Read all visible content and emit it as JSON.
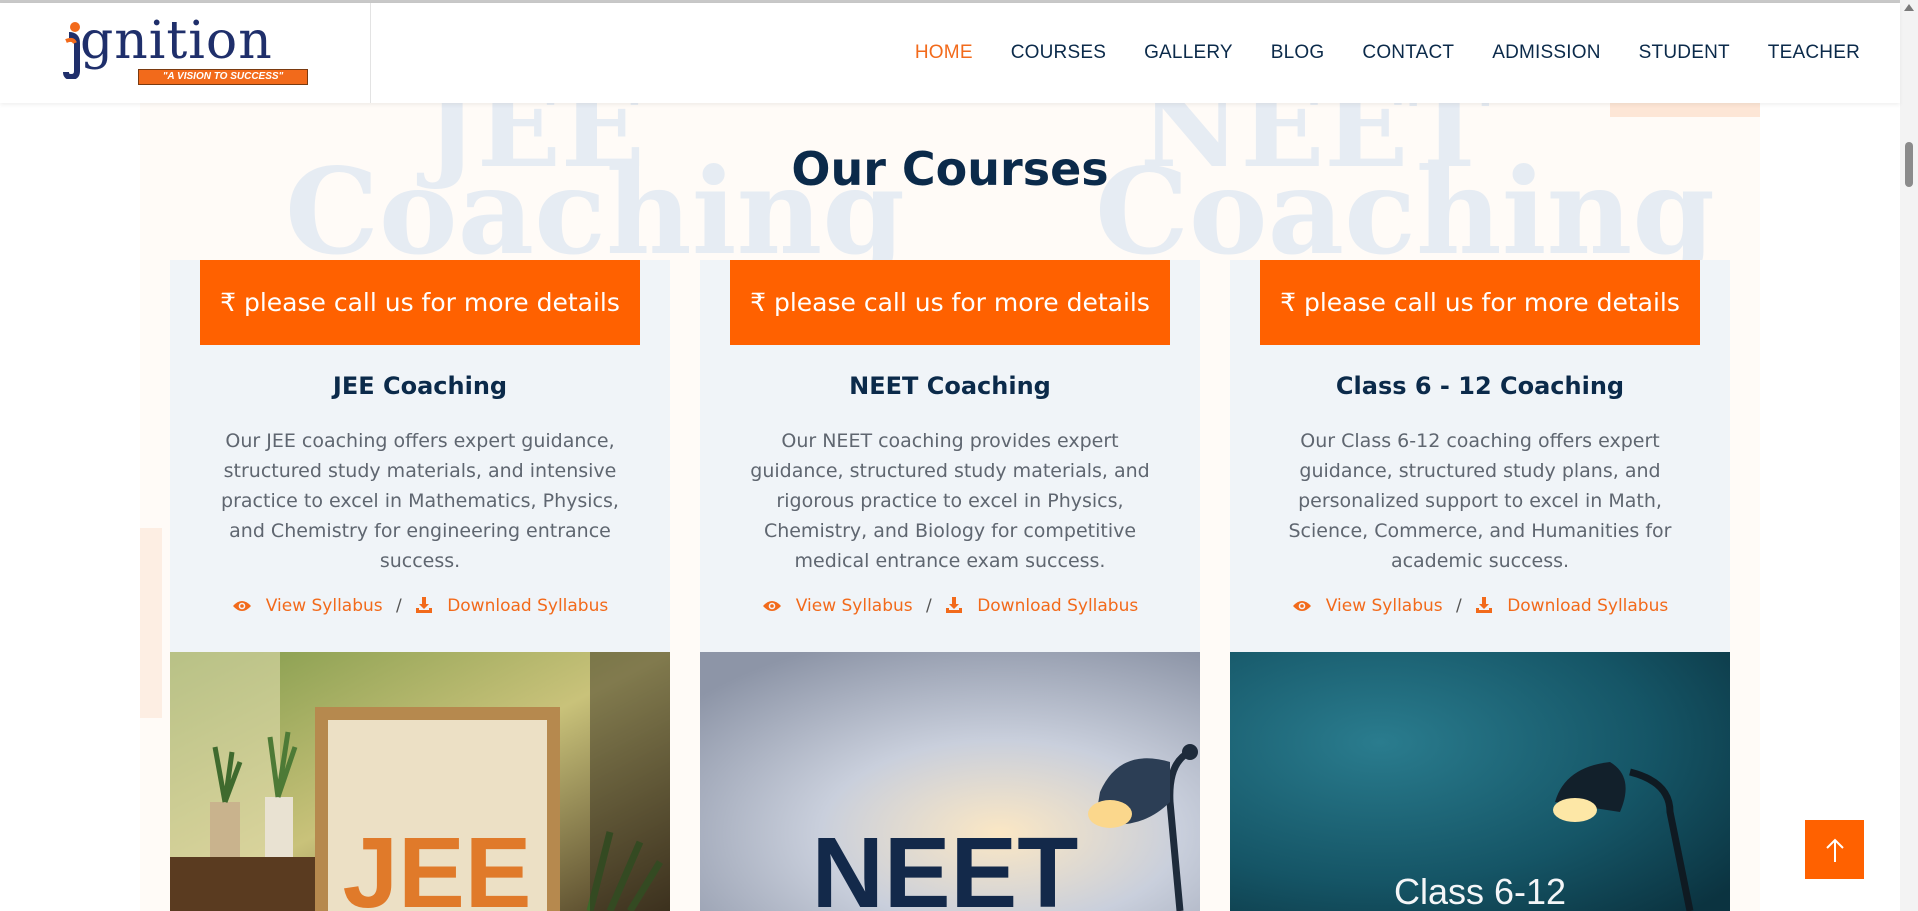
{
  "brand": {
    "logo_text": "gnition",
    "tagline": "\"A VISION TO SUCCESS\""
  },
  "nav": {
    "items": [
      {
        "label": "HOME",
        "active": true
      },
      {
        "label": "COURSES"
      },
      {
        "label": "GALLERY"
      },
      {
        "label": "BLOG"
      },
      {
        "label": "CONTACT"
      },
      {
        "label": "ADMISSION"
      },
      {
        "label": "STUDENT"
      },
      {
        "label": "TEACHER"
      }
    ]
  },
  "watermark": {
    "word1": "JEE",
    "word2": "NEET",
    "word3": "Coaching"
  },
  "section": {
    "title": "Our Courses"
  },
  "courses": [
    {
      "price": "₹ please call us for more details",
      "title": "JEE Coaching",
      "description": "Our JEE coaching offers expert guidance, structured study materials, and intensive practice to excel in Mathematics, Physics, and Chemistry for engineering entrance success.",
      "view_label": "View Syllabus",
      "separator": "/",
      "download_label": "Download Syllabus",
      "image_text": "JEE"
    },
    {
      "price": "₹ please call us for more details",
      "title": "NEET Coaching",
      "description": "Our NEET coaching provides expert guidance, structured study materials, and rigorous practice to excel in Physics, Chemistry, and Biology for competitive medical entrance exam success.",
      "view_label": "View Syllabus",
      "separator": "/",
      "download_label": "Download Syllabus",
      "image_text": "NEET"
    },
    {
      "price": "₹ please call us for more details",
      "title": "Class 6 - 12 Coaching",
      "description": "Our Class 6-12 coaching offers expert guidance, structured study plans, and personalized support to excel in Math, Science, Commerce, and Humanities for academic success.",
      "view_label": "View Syllabus",
      "separator": "/",
      "download_label": "Download Syllabus",
      "image_text": "Class 6-12"
    }
  ],
  "colors": {
    "accent": "#ff6100",
    "navy": "#0b2a4a",
    "card_bg": "#f0f4f8"
  }
}
